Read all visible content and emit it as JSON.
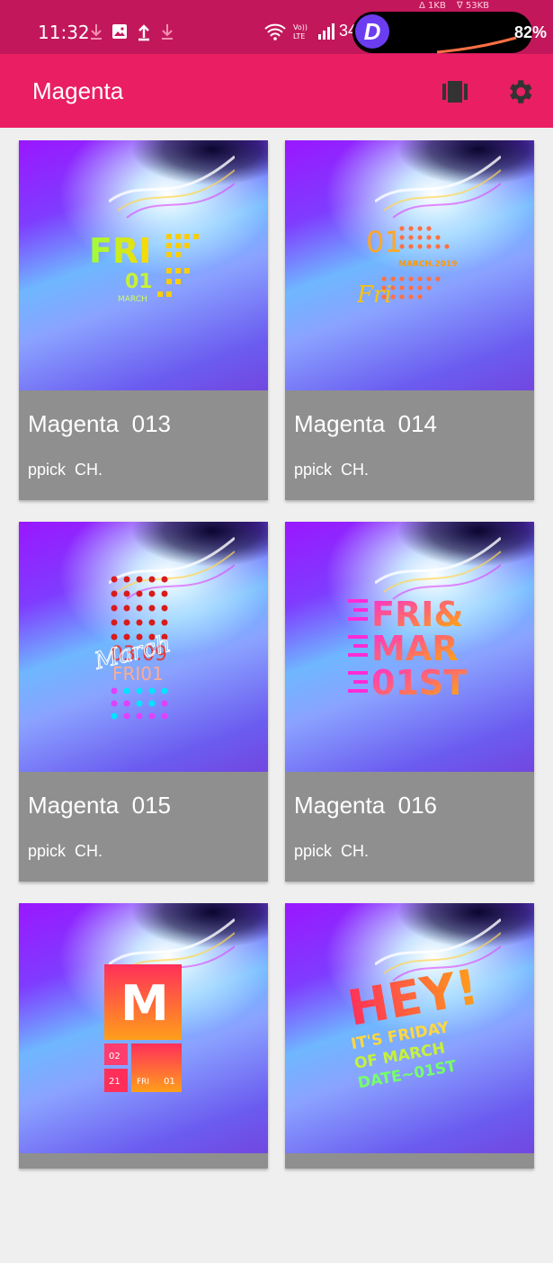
{
  "status_bar": {
    "time": "11:32",
    "net_up": "Δ 1KB",
    "net_down": "∇ 53KB",
    "signal_text": "34",
    "battery": "82%",
    "overlay_logo": "D",
    "icons": [
      "download-icon",
      "image-icon",
      "upload-icon",
      "download-icon",
      "wifi-icon",
      "volte-icon",
      "signal-icon"
    ]
  },
  "app_bar": {
    "title": "Magenta",
    "actions": [
      "gallery-icon",
      "settings-icon"
    ],
    "accent": "#e91e63",
    "status_color": "#c2185b"
  },
  "cards": [
    {
      "name": "Magenta  013",
      "author": "ppick  CH.",
      "art_text": [
        "FRI",
        "01",
        "MARCH"
      ]
    },
    {
      "name": "Magenta  014",
      "author": "ppick  CH.",
      "art_text": [
        "01",
        "MARCH.2019",
        "Fri"
      ]
    },
    {
      "name": "Magenta  015",
      "author": "ppick  CH.",
      "art_text": [
        "03.09",
        "March",
        "FRI01"
      ]
    },
    {
      "name": "Magenta  016",
      "author": "ppick  CH.",
      "art_text": [
        "FRI&",
        "MAR",
        "01ST"
      ]
    },
    {
      "name": "",
      "author": "",
      "art_text": [
        "M",
        "02",
        "21",
        "FRI",
        "01"
      ]
    },
    {
      "name": "",
      "author": "",
      "art_text": [
        "HEY!",
        "IT'S FRIDAY",
        "OF MARCH",
        "DATE~01ST"
      ]
    }
  ]
}
